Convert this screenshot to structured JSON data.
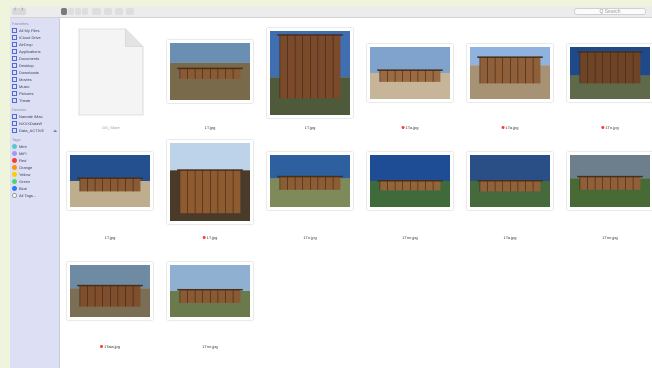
{
  "window": {
    "search_placeholder": "Q Search"
  },
  "sidebar": {
    "favorites_heading": "Favorites",
    "favorites": [
      {
        "label": "All My Files",
        "icon": "all-files-icon"
      },
      {
        "label": "iCloud Drive",
        "icon": "cloud-icon"
      },
      {
        "label": "AirDrop",
        "icon": "airdrop-icon"
      },
      {
        "label": "Applications",
        "icon": "applications-icon"
      },
      {
        "label": "Documents",
        "icon": "documents-icon"
      },
      {
        "label": "Desktop",
        "icon": "desktop-icon"
      },
      {
        "label": "Downloads",
        "icon": "downloads-icon"
      },
      {
        "label": "Movies",
        "icon": "movies-icon"
      },
      {
        "label": "Music",
        "icon": "music-icon"
      },
      {
        "label": "Pictures",
        "icon": "pictures-icon"
      },
      {
        "label": "Theatr",
        "icon": "folder-icon"
      }
    ],
    "devices_heading": "Devices",
    "devices": [
      {
        "label": "Namate iMac",
        "icon": "imac-icon",
        "eject": false
      },
      {
        "label": "NXXXDataW",
        "icon": "disk-icon",
        "eject": false
      },
      {
        "label": "Data_ACTIVE",
        "icon": "disk-icon",
        "eject": true
      }
    ],
    "tags_heading": "Tags",
    "tags": [
      {
        "label": "Mint",
        "color": "#5ac8c8"
      },
      {
        "label": "MiFi",
        "color": "#a29af0"
      },
      {
        "label": "Red",
        "color": "#ff3b30"
      },
      {
        "label": "Orange",
        "color": "#ff9500"
      },
      {
        "label": "Yellow",
        "color": "#ffcc00"
      },
      {
        "label": "Green",
        "color": "#4cd964"
      },
      {
        "label": "Blue",
        "color": "#2f7bf6"
      },
      {
        "label": "All Tags...",
        "color": "#ffffff"
      }
    ]
  },
  "files": [
    {
      "name": "DS_Store",
      "tagged": false,
      "kind": "document"
    },
    {
      "name": "1T.jpg",
      "tagged": false,
      "kind": "photo"
    },
    {
      "name": "1T.jpg",
      "tagged": false,
      "kind": "photo"
    },
    {
      "name": "1Ta.jpg",
      "tagged": true,
      "kind": "photo"
    },
    {
      "name": "1Ta.jpg",
      "tagged": true,
      "kind": "photo"
    },
    {
      "name": "1Tn.jpg",
      "tagged": true,
      "kind": "photo"
    },
    {
      "name": "1T.jpg",
      "tagged": false,
      "kind": "photo"
    },
    {
      "name": "1T.jpg",
      "tagged": true,
      "kind": "photo"
    },
    {
      "name": "1Tn.jpg",
      "tagged": false,
      "kind": "photo"
    },
    {
      "name": "1Tnn.jpg",
      "tagged": false,
      "kind": "photo"
    },
    {
      "name": "1Ta.jpg",
      "tagged": false,
      "kind": "photo"
    },
    {
      "name": "1Tnn.jpg",
      "tagged": false,
      "kind": "photo"
    },
    {
      "name": "1Tala.jpg",
      "tagged": true,
      "kind": "photo"
    },
    {
      "name": "1Tnn.jpg",
      "tagged": false,
      "kind": "photo"
    }
  ]
}
